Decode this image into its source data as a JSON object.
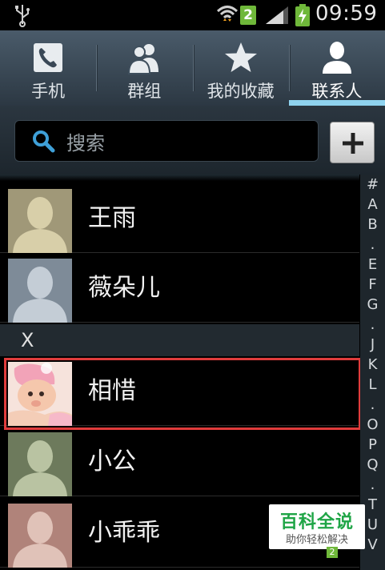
{
  "status_bar": {
    "sim_badge": "2",
    "time": "09:59",
    "colors": {
      "sim_badge": "#6fb83a",
      "battery": "#6fb83a"
    }
  },
  "tabs": [
    {
      "label": "手机",
      "icon": "phone-icon",
      "active": false
    },
    {
      "label": "群组",
      "icon": "group-icon",
      "active": false
    },
    {
      "label": "我的收藏",
      "icon": "star-icon",
      "active": false
    },
    {
      "label": "联系人",
      "icon": "person-icon",
      "active": true
    }
  ],
  "search": {
    "placeholder": "搜索",
    "icon": "search-icon",
    "add_icon": "plus-icon"
  },
  "contacts": [
    {
      "name": "王雨",
      "avatar": "default-avatar",
      "avatar_bg": "#a09878"
    },
    {
      "name": "薇朵儿",
      "avatar": "default-avatar",
      "avatar_bg": "#7e8b98"
    }
  ],
  "section_x": {
    "header": "X",
    "contacts": [
      {
        "name": "相惜",
        "avatar": "baby-photo",
        "highlighted": true
      },
      {
        "name": "小公",
        "avatar": "default-avatar",
        "avatar_bg": "#6d7a5c"
      },
      {
        "name": "小乖乖",
        "avatar": "default-avatar",
        "avatar_bg": "#b0837a"
      }
    ]
  },
  "index_bar": [
    "#",
    "A",
    "B",
    ".",
    "E",
    "F",
    "G",
    ".",
    "J",
    "K",
    "L",
    ".",
    "O",
    "P",
    "Q",
    ".",
    "T",
    "U",
    "V"
  ],
  "watermark": {
    "title": "百科全说",
    "subtitle": "助你轻松解决",
    "badge": "2"
  }
}
